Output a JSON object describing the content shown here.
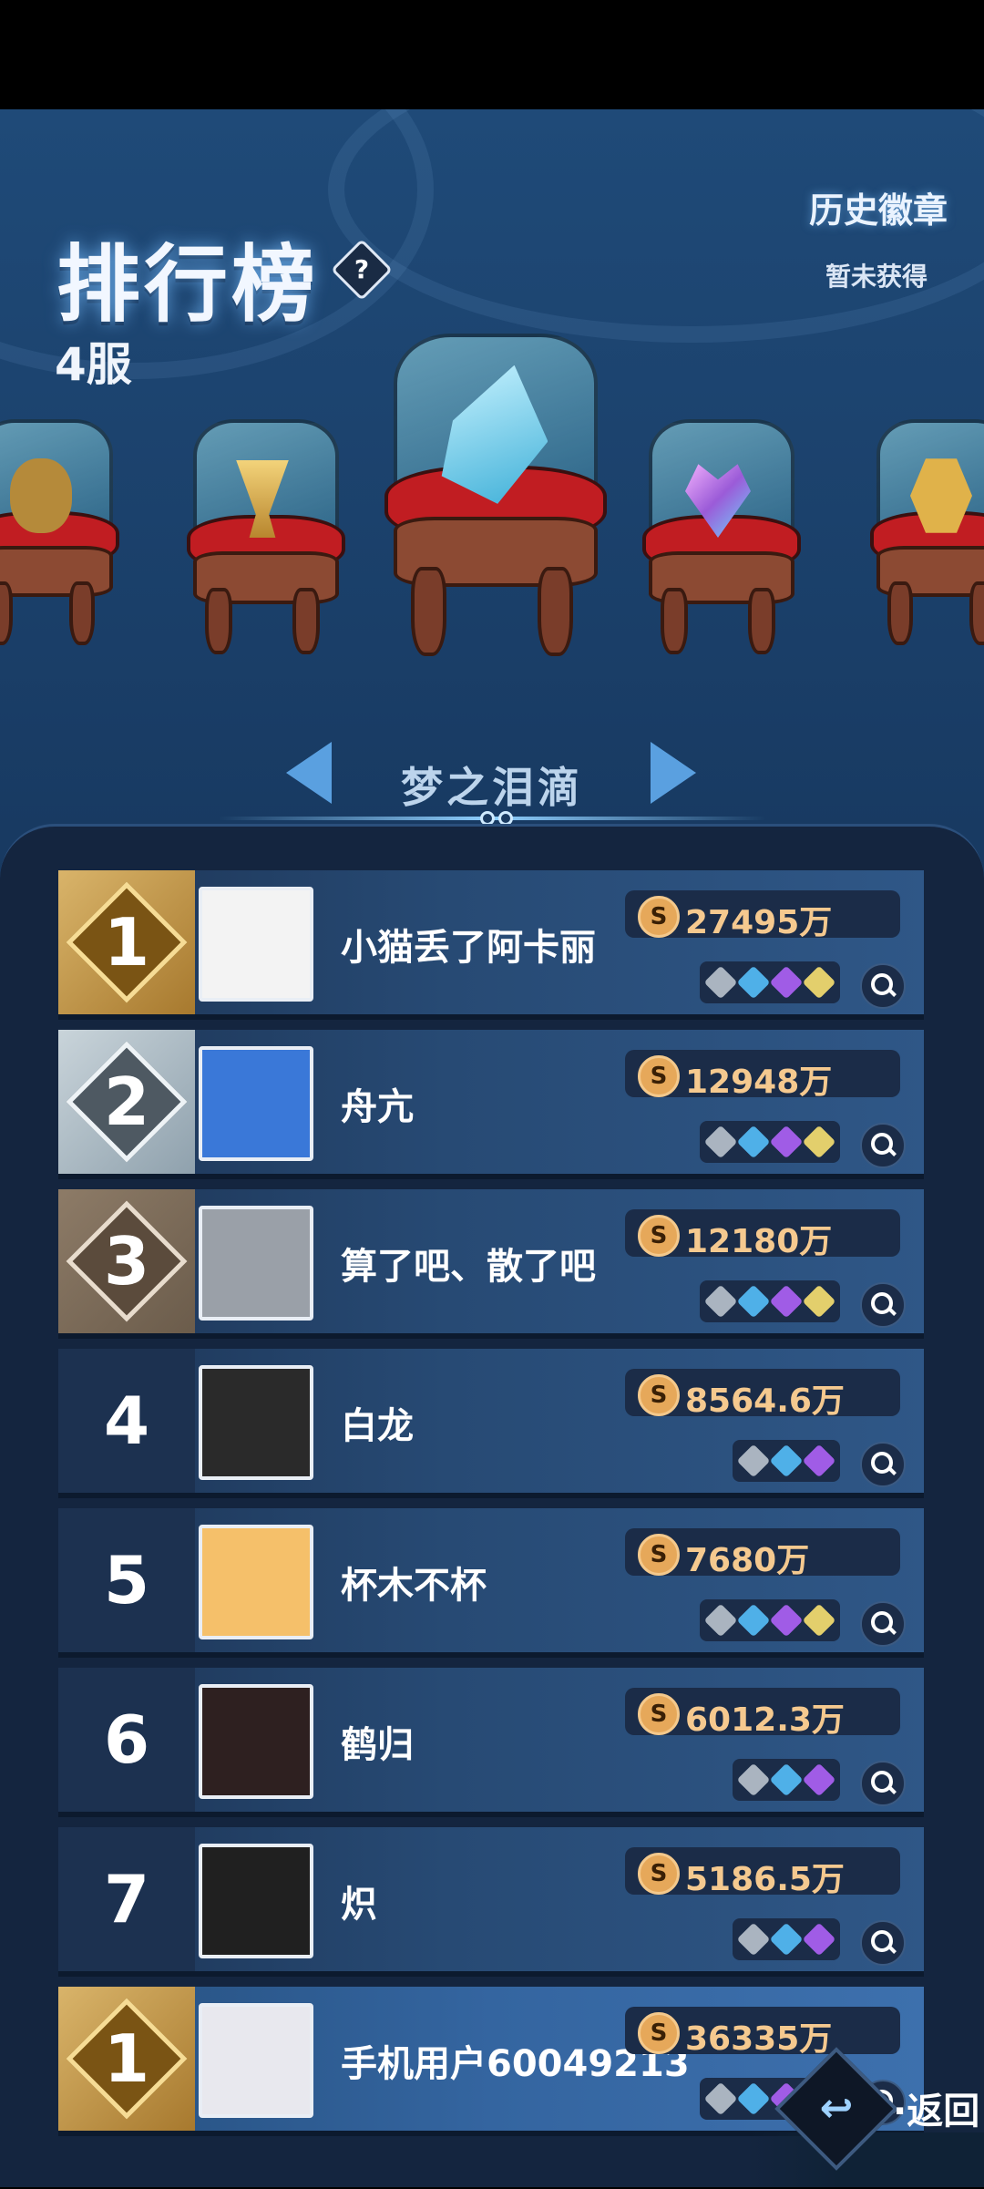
{
  "header": {
    "title": "排行榜",
    "help_icon": "?",
    "server": "4服",
    "badges_title": "历史徽章",
    "badges_status": "暂未获得"
  },
  "carousel": {
    "selected_name": "梦之泪滴",
    "items": [
      "turtle-trophy",
      "gold-cup",
      "dream-teardrop",
      "crystal-heart",
      "bitcoin-badge"
    ]
  },
  "rankings": [
    {
      "rank": "1",
      "name": "小猫丢了阿卡丽",
      "coins": "27495万",
      "gems": [
        "gray",
        "blue",
        "purple",
        "gold"
      ],
      "tier": "gold"
    },
    {
      "rank": "2",
      "name": "舟亢",
      "coins": "12948万",
      "gems": [
        "gray",
        "blue",
        "purple",
        "gold"
      ],
      "tier": "silver"
    },
    {
      "rank": "3",
      "name": "算了吧、散了吧",
      "coins": "12180万",
      "gems": [
        "gray",
        "blue",
        "purple",
        "gold"
      ],
      "tier": "bronze"
    },
    {
      "rank": "4",
      "name": "白龙",
      "coins": "8564.6万",
      "gems": [
        "gray",
        "blue",
        "purple"
      ],
      "tier": "plain"
    },
    {
      "rank": "5",
      "name": "杯木不杯",
      "coins": "7680万",
      "gems": [
        "gray",
        "blue",
        "purple",
        "gold"
      ],
      "tier": "plain"
    },
    {
      "rank": "6",
      "name": "鹤归",
      "coins": "6012.3万",
      "gems": [
        "gray",
        "blue",
        "purple"
      ],
      "tier": "plain"
    },
    {
      "rank": "7",
      "name": "炽",
      "coins": "5186.5万",
      "gems": [
        "gray",
        "blue",
        "purple"
      ],
      "tier": "plain"
    }
  ],
  "my_rank": {
    "rank": "1",
    "name": "手机用户60049213",
    "coins": "36335万",
    "gems": [
      "gray",
      "blue",
      "purple",
      "gold"
    ],
    "tier": "gold"
  },
  "coin_symbol": "S",
  "footer": {
    "back_label": "·返回",
    "back_icon": "↩"
  },
  "colors": {
    "background": "#1f4a78",
    "panel": "#14253f",
    "coin_text": "#f5c98f",
    "gold": "#d9b46a"
  }
}
